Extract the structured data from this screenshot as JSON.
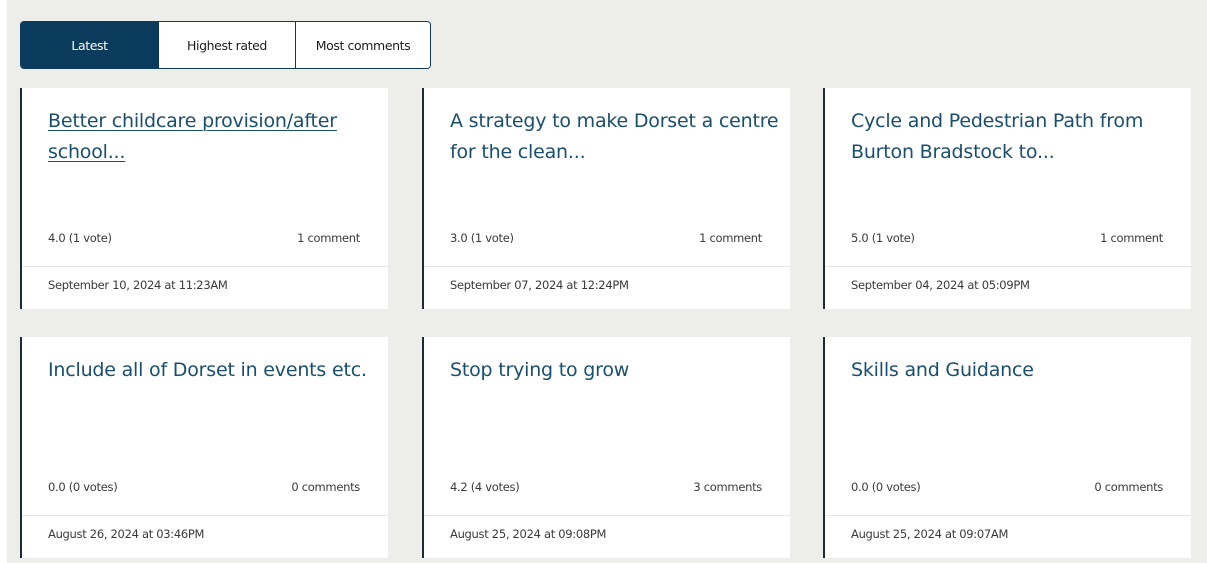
{
  "tabs": {
    "latest": "Latest",
    "highest_rated": "Highest rated",
    "most_comments": "Most comments"
  },
  "cards": [
    {
      "title": "Better childcare provision/after school...",
      "rating": "4.0 (1 vote)",
      "comments": "1 comment",
      "date": "September 10, 2024 at 11:23AM"
    },
    {
      "title": "A strategy to make Dorset a centre for the clean...",
      "rating": "3.0 (1 vote)",
      "comments": "1 comment",
      "date": "September 07, 2024 at 12:24PM"
    },
    {
      "title": "Cycle and Pedestrian Path from Burton Bradstock to...",
      "rating": "5.0 (1 vote)",
      "comments": "1 comment",
      "date": "September 04, 2024 at 05:09PM"
    },
    {
      "title": "Include all of Dorset in events etc.",
      "rating": "0.0 (0 votes)",
      "comments": "0 comments",
      "date": "August 26, 2024 at 03:46PM"
    },
    {
      "title": "Stop trying to grow",
      "rating": "4.2 (4 votes)",
      "comments": "3 comments",
      "date": "August 25, 2024 at 09:08PM"
    },
    {
      "title": "Skills and Guidance",
      "rating": "0.0 (0 votes)",
      "comments": "0 comments",
      "date": "August 25, 2024 at 09:07AM"
    }
  ],
  "colors": {
    "accent": "#0a3a5c",
    "title": "#194f6d",
    "background": "#ededea"
  }
}
